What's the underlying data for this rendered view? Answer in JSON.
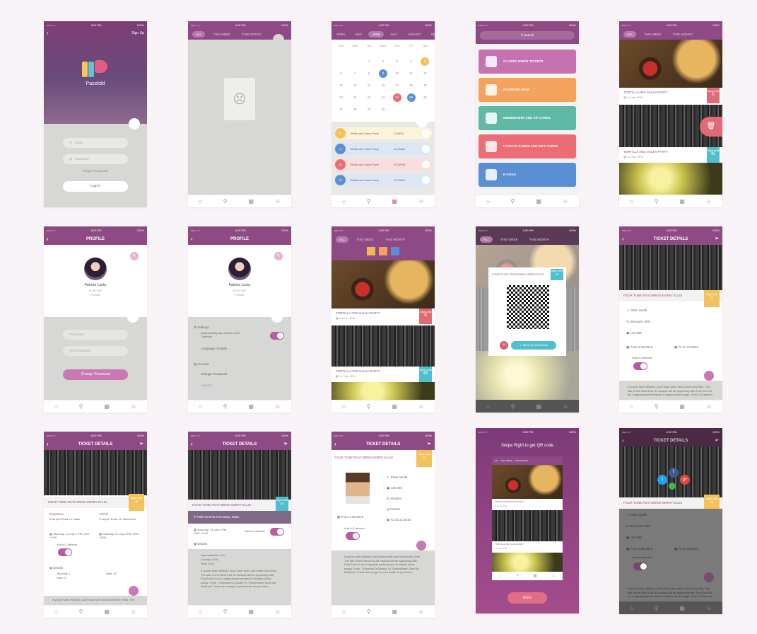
{
  "status": {
    "carrier": "•••○○ ≈",
    "time": "6:00 PM",
    "battery": "100%"
  },
  "login": {
    "signup": "Sign Up",
    "brand": "Passfold",
    "email": "Email",
    "password": "Password",
    "forgot": "Forgot Password?",
    "login": "Log in"
  },
  "tabs": {
    "all": "ALL",
    "week": "THIS WEEK",
    "month": "THIS MONTH"
  },
  "months": [
    "APRIL",
    "MAY",
    "JUNE",
    "JULY",
    "AUGUST",
    "SEPT"
  ],
  "weekdays": [
    "Sun",
    "Mon",
    "Tue",
    "Wed",
    "Thu",
    "Fri",
    "Sat"
  ],
  "calendar_rows": [
    [
      "",
      "",
      "1",
      "2",
      "3",
      "4",
      "5"
    ],
    [
      "6",
      "7",
      "8",
      "9",
      "10",
      "11",
      "12"
    ],
    [
      "13",
      "14",
      "15",
      "16",
      "17",
      "18",
      "19"
    ],
    [
      "20",
      "21",
      "22",
      "23",
      "24",
      "25",
      "26"
    ],
    [
      "27",
      "28",
      "29",
      "30",
      "",
      "",
      ""
    ]
  ],
  "cal_events": [
    {
      "day": "5",
      "title": "Tortilla and Salsa Party",
      "time": "2:30PM"
    },
    {
      "day": "9",
      "title": "Tortilla and Salsa Party",
      "time": "11:30AM"
    },
    {
      "day": "24",
      "title": "Tortilla and Salsa Party",
      "time": "10:30PM"
    },
    {
      "day": "25",
      "title": "Tortilla and Salsa Party",
      "time": "11:30AM"
    }
  ],
  "search": "Search",
  "categories": [
    {
      "label": "CLASSIC EVENT TICKETS",
      "color": "#c772b0"
    },
    {
      "label": "BOARDING PASS",
      "color": "#f3a35c"
    },
    {
      "label": "MEMBERSHIP AND VIP CARDS",
      "color": "#5fb9a5"
    },
    {
      "label": "LOYALTY CARDS AND GIFT CARDS",
      "color": "#ee6c74"
    },
    {
      "label": "E-VISAS",
      "color": "#5a8fd3"
    }
  ],
  "events": [
    {
      "title": "TORTILLA AND SALSA PARTY",
      "date": "8 June, 4PM",
      "tag": "days until",
      "num": "8"
    },
    {
      "title": "TORTILLA AND SALSA PARTY",
      "date": "14 July, 4PM",
      "tag": "days until",
      "num": "45"
    }
  ],
  "profile": {
    "title": "PROFILE",
    "name": "Patricia Lucky",
    "dob": "15.08.1987",
    "gender": "Female",
    "password": "Password",
    "newpass": "New Password",
    "change": "Change Password",
    "settings": "Settings",
    "auto": "Automatically add events to the Calendar",
    "language": "Language: English",
    "account": "Account",
    "change2": "Change Password",
    "logout": "Log Out"
  },
  "ticket": {
    "title": "TICKET DETAILS",
    "event": "FOUR TUNE FEATURING KERRY ELLIS",
    "name": "Peter Smith",
    "discount": "Discount: 50%",
    "price": "146 306",
    "student": "Student",
    "country": "France",
    "from_label": "From",
    "from": "1.06.2015",
    "to_label": "To",
    "to": "31.12.2015",
    "add": "Add to Calendar",
    "departure": "Departure",
    "dep_addr": "Airport Road 16, Baku",
    "arrival": "Arrival",
    "arr_addr": "Airport Road 16, Barcelona",
    "dep_time": "Saturday, 14 July 4 PM, GMT +3:00",
    "arr_time": "Saturday, 14 July 4 PM, GMT +3:00",
    "details": "Details",
    "terminal": "Terminal: 1",
    "gate": "Gate: 4",
    "seat": "Seat: 33",
    "place": "Park Cinema Port Baku, Baku",
    "datetime": "Saturday, 14 July 4 PM, GMT +3:00",
    "age": "Age restriction: 18+",
    "cntry": "Country: USA",
    "year": "Year: 2015",
    "desc": "If you've seen Wicked, you'll have seen and loved Kerry Ellis. The star of the West End hit musical will be appearing with FourTune for an a cappella performance of classic show songs. From \"I Dreamed a Dream\" to \"Somewhere Over the Rainbow\", these are songs to put a smile on your face.",
    "mark": "Mark as Redeemed",
    "swipe": "Swipe Right to get QR code",
    "done": "Done"
  },
  "colors": {
    "purple": "#8e4a84",
    "pink": "#d0608a",
    "gray": "#d7d8d5"
  }
}
